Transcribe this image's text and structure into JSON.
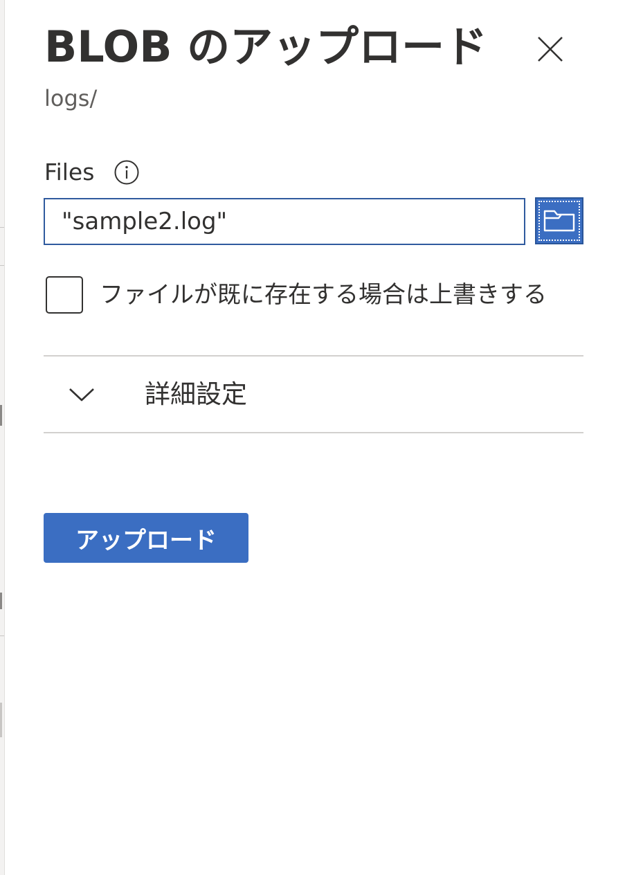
{
  "panel": {
    "title": "BLOB のアップロード",
    "path": "logs/",
    "close_icon": "close-icon"
  },
  "files": {
    "label": "Files",
    "info_icon": "info-icon",
    "value": "\"sample2.log\"",
    "browse_icon": "folder-icon"
  },
  "overwrite": {
    "label": "ファイルが既に存在する場合は上書きする",
    "checked": false
  },
  "advanced": {
    "label": "詳細設定",
    "icon": "chevron-down-icon",
    "expanded": false
  },
  "actions": {
    "upload_label": "アップロード"
  },
  "colors": {
    "accent": "#3b6ec2",
    "input_border": "#2f5a9e",
    "text": "#323130",
    "muted_text": "#605e5c",
    "divider": "#d2d0ce"
  }
}
